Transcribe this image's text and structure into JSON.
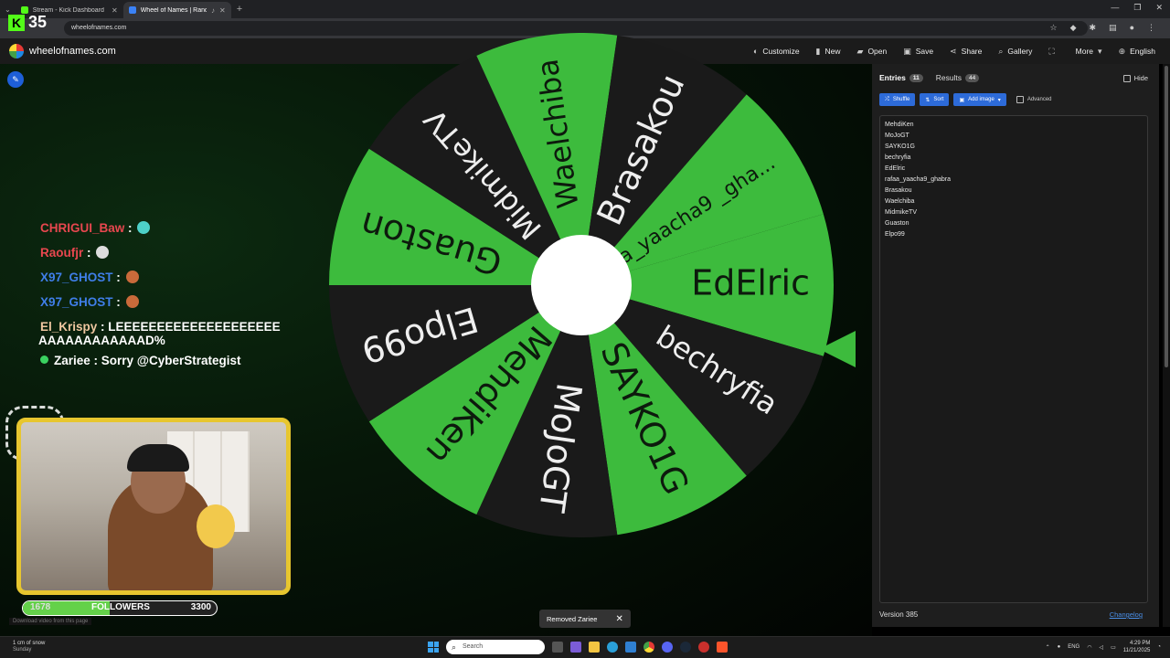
{
  "browser": {
    "tabs": [
      {
        "title": "Stream - Kick Dashboard",
        "fav": "#53fc18",
        "active": false
      },
      {
        "title": "Wheel of Names | Random",
        "fav": "#3b82f6",
        "active": true
      }
    ],
    "url": "wheelofnames.com",
    "overlay_count": "35"
  },
  "site": {
    "name": "wheelofnames.com",
    "menu": [
      {
        "label": "Customize",
        "icon": "palette-icon",
        "glyph": "◐"
      },
      {
        "label": "New",
        "icon": "file-icon",
        "glyph": "▮"
      },
      {
        "label": "Open",
        "icon": "folder-icon",
        "glyph": "▰"
      },
      {
        "label": "Save",
        "icon": "save-icon",
        "glyph": "▣"
      },
      {
        "label": "Share",
        "icon": "share-icon",
        "glyph": "⋖"
      },
      {
        "label": "Gallery",
        "icon": "search-icon",
        "glyph": "⌕"
      },
      {
        "label": "",
        "icon": "fullscreen-icon",
        "glyph": "⛶"
      },
      {
        "label": "More",
        "icon": "chevron-down-icon",
        "glyph": "▾"
      },
      {
        "label": "English",
        "icon": "globe-icon",
        "glyph": "⊕"
      }
    ]
  },
  "wheel": {
    "colors": {
      "green": "#3dbb3d",
      "dark": "#1a1a1a",
      "text_on_green": "#0d1a0d",
      "text_on_dark": "#eeeeee"
    },
    "segments": [
      "EdElric",
      "bechryfia",
      "SAYKO1G",
      "MoJoGT",
      "MehdiKen",
      "Elpo99",
      "Guaston",
      "MidmikeTV",
      "Waelchiba",
      "Brasakou",
      "rafaa_yaacha9 _gha..."
    ]
  },
  "chat": [
    {
      "user": "CHRIGUI_Baw",
      "color": "#e8474f",
      "msg": "",
      "emoji": "#4dd0c8"
    },
    {
      "user": "Raoufjr",
      "color": "#e8474f",
      "msg": "",
      "emoji": "#dddddd"
    },
    {
      "user": "X97_GHOST",
      "color": "#3f7ee8",
      "msg": "",
      "emoji": "#c96a3a"
    },
    {
      "user": "X97_GHOST",
      "color": "#3f7ee8",
      "msg": "",
      "emoji": "#c96a3a"
    },
    {
      "user": "El_Krispy",
      "color": "#f0c7a0",
      "msg": "LEEEEEEEEEEEEEEEEEEEE",
      "emoji": ""
    }
  ],
  "chat_wrap": "AAAAAAAAAAAAD%",
  "chat_last": {
    "user": "Zariee",
    "msg": "Sorry @CyberStrategist"
  },
  "followers": {
    "current": "1678",
    "label": "FOLLOWERS",
    "goal": "3300",
    "progress": 0.45
  },
  "download_hint": "Download video from this page",
  "toast": {
    "text": "Removed Zariee"
  },
  "panel": {
    "tab_entries": "Entries",
    "entries_count": "11",
    "tab_results": "Results",
    "results_count": "44",
    "hide_label": "Hide",
    "shuffle_label": "Shuffle",
    "sort_label": "Sort",
    "add_image_label": "Add image",
    "advanced_label": "Advanced",
    "entries": [
      "MehdiKen",
      "MoJoGT",
      "SAYKO1G",
      "bechryfia",
      "EdElric",
      "rafaa_yaacha9_ghabra",
      "Brasakou",
      "Waelchiba",
      "MidmikeTV",
      "Guaston",
      "Elpo99"
    ],
    "version": "Version 385",
    "changelog": "Changelog"
  },
  "taskbar": {
    "weather": "1 cm of snow",
    "day": "Sunday",
    "search_placeholder": "Search",
    "lang": "ENG",
    "time": "4:29 PM",
    "date": "11/21/2025"
  }
}
